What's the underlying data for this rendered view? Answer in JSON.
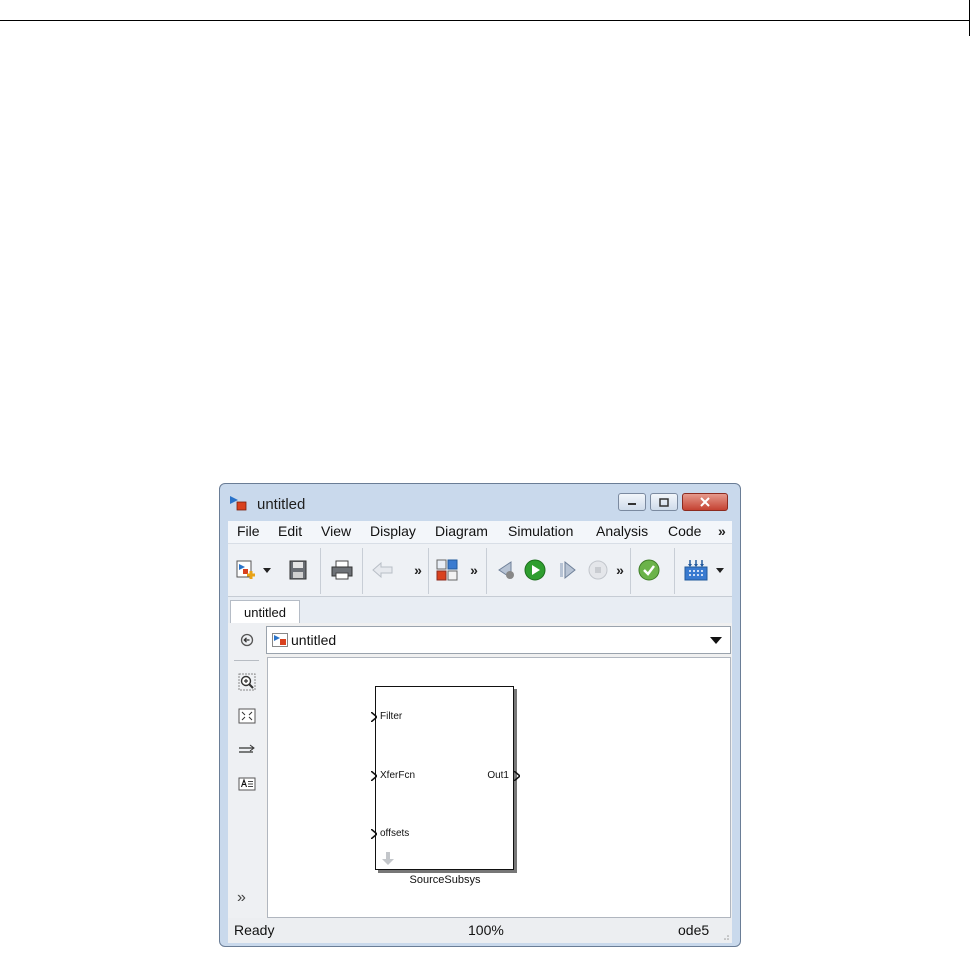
{
  "window": {
    "title": "untitled",
    "minimize_label": "",
    "maximize_label": "",
    "close_label": ""
  },
  "menu": {
    "items": [
      "File",
      "Edit",
      "View",
      "Display",
      "Diagram",
      "Simulation",
      "Analysis",
      "Code"
    ],
    "overflow": "»"
  },
  "toolbar": {
    "overflow": "»"
  },
  "tabs": [
    {
      "label": "untitled"
    }
  ],
  "address": {
    "model_name": "untitled"
  },
  "palette": {
    "more": "»"
  },
  "block": {
    "name": "SourceSubsys",
    "inputs": [
      "Filter",
      "XferFcn",
      "offsets"
    ],
    "outputs": [
      "Out1"
    ]
  },
  "status": {
    "state": "Ready",
    "zoom": "100%",
    "solver": "ode5"
  },
  "colors": {
    "window_frame": "#c9d9ec",
    "close_button": "#c44232",
    "run_button": "#2f9e2f"
  }
}
